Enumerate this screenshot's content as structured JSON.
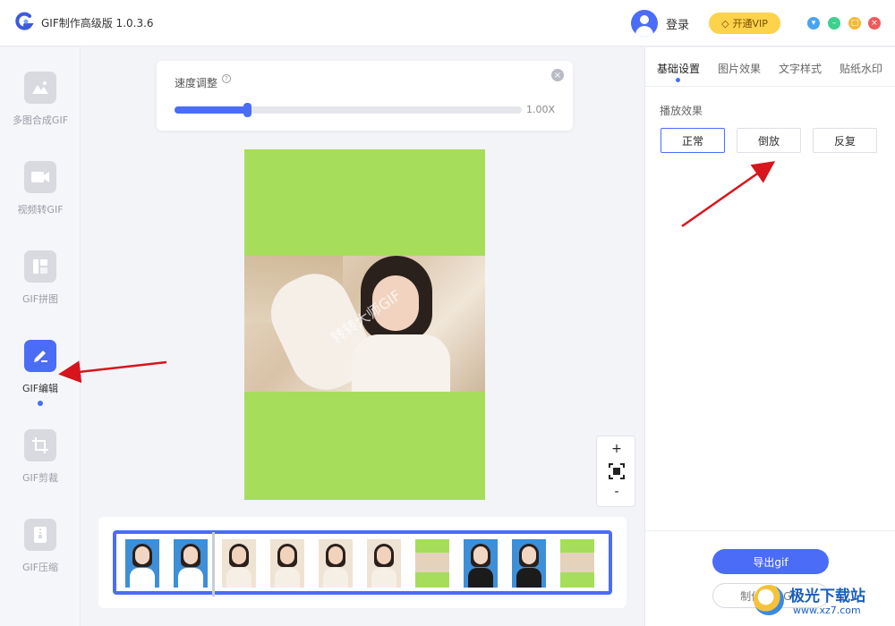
{
  "app": {
    "title": "GIF制作高级版 1.0.3.6",
    "login": "登录",
    "vip": "开通VIP"
  },
  "window_controls": [
    "menu-icon",
    "minimize-icon",
    "maximize-icon",
    "close-icon"
  ],
  "sidebar": {
    "items": [
      {
        "label": "多图合成GIF",
        "icon": "mountain-image-icon",
        "active": false
      },
      {
        "label": "视频转GIF",
        "icon": "video-camera-icon",
        "active": false
      },
      {
        "label": "GIF拼图",
        "icon": "collage-icon",
        "active": false
      },
      {
        "label": "GIF编辑",
        "icon": "edit-pen-icon",
        "active": true
      },
      {
        "label": "GIF剪裁",
        "icon": "crop-icon",
        "active": false
      },
      {
        "label": "GIF压缩",
        "icon": "zip-file-icon",
        "active": false
      }
    ]
  },
  "speed": {
    "label": "速度调整",
    "value": "1.00X",
    "slider_fraction": 0.21
  },
  "preview": {
    "watermark": "转转大师GIF",
    "background": "#a6dd5b"
  },
  "zoom": {
    "plus": "+",
    "minus": "-"
  },
  "right_panel": {
    "tabs": [
      "基础设置",
      "图片效果",
      "文字样式",
      "贴纸水印"
    ],
    "active_tab": 0,
    "section_label": "播放效果",
    "options": [
      "正常",
      "倒放",
      "反复"
    ],
    "selected_option": 0,
    "export_label": "导出gif",
    "new_label": "制作新的GIF"
  },
  "site_badge": {
    "name": "极光下载站",
    "url": "www.xz7.com"
  },
  "colors": {
    "accent": "#4a6cf7",
    "vip": "#fcd34a",
    "arrow": "#d8141c",
    "preview_green": "#a6dd5b"
  }
}
